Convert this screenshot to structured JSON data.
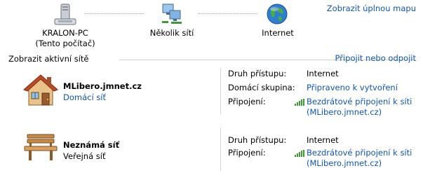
{
  "map": {
    "view_full_map": "Zobrazit úplnou mapu",
    "nodes": [
      {
        "label_line1": "KRALON-PC",
        "label_line2": "(Tento počítač)"
      },
      {
        "label_line1": "Několik sítí"
      },
      {
        "label_line1": "Internet"
      }
    ]
  },
  "active_networks": {
    "title": "Zobrazit aktivní sítě",
    "connect_link": "Připojit nebo odpojit"
  },
  "networks": [
    {
      "name": "MLibero.jmnet.cz",
      "type": "Domácí síť",
      "access_label": "Druh přístupu:",
      "access_value": "Internet",
      "homegroup_label": "Domácí skupina:",
      "homegroup_value": "Připraveno k vytvoření",
      "connections_label": "Připojení:",
      "connection_line1": "Bezdrátové připojení k síti",
      "connection_line2": "(MLibero.jmnet.cz)"
    },
    {
      "name": "Neznámá síť",
      "type": "Veřejná síť",
      "access_label": "Druh přístupu:",
      "access_value": "Internet",
      "connections_label": "Připojení:",
      "connection_line1": "Bezdrátové připojení k síti",
      "connection_line2": "(MLibero.jmnet.cz)"
    }
  ],
  "colors": {
    "link": "#0f56b3",
    "signal": "#3d9b35"
  }
}
